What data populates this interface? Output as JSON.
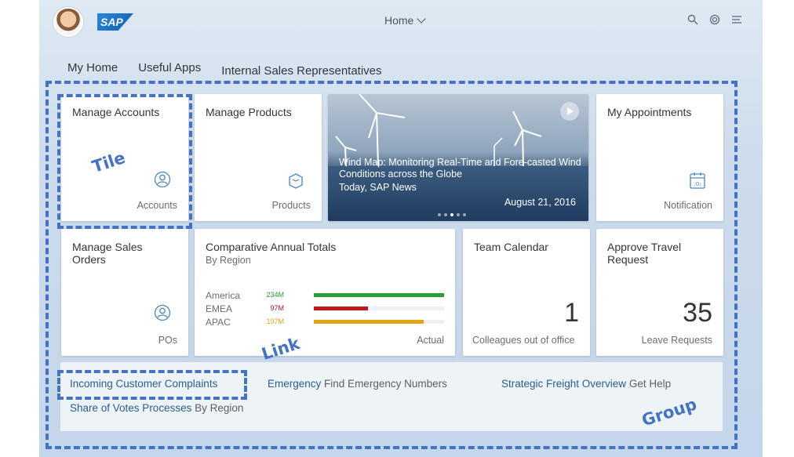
{
  "shell": {
    "home_label": "Home",
    "logo_text": "SAP",
    "icons": [
      "search-icon",
      "copilot-icon",
      "notifications-icon"
    ]
  },
  "tabs": [
    "My Home",
    "Useful Apps",
    "Internal Sales Representatives"
  ],
  "tiles": {
    "manage_accounts": {
      "title": "Manage Accounts",
      "footer": "Accounts",
      "icon": "person-icon"
    },
    "manage_products": {
      "title": "Manage Products",
      "footer": "Products",
      "icon": "product-icon"
    },
    "news": {
      "headline": "Wind Map: Monitoring Real-Time and Fore-casted Wind Conditions across the Globe",
      "source": "Today, SAP News",
      "date": "August 21, 2016"
    },
    "my_appointments": {
      "title": "My Appointments",
      "footer": "Notification",
      "icon": "calendar-icon"
    },
    "manage_sales_orders": {
      "title": "Manage Sales Orders",
      "footer": "POs",
      "icon": "person-icon"
    },
    "comparative": {
      "title": "Comparative Annual Totals",
      "subtitle": "By Region",
      "footer": "Actual",
      "rows": [
        {
          "label": "America",
          "value_label": "234M",
          "value": 234,
          "color": "#2b9d3a"
        },
        {
          "label": "EMEA",
          "value_label": "97M",
          "value": 97,
          "color": "#c0161e"
        },
        {
          "label": "APAC",
          "value_label": "197M",
          "value": 197,
          "color": "#e3a21a"
        }
      ]
    },
    "team_calendar": {
      "title": "Team Calendar",
      "kpi": "1",
      "footer": "Colleagues out of office"
    },
    "approve_travel": {
      "title": "Approve Travel Request",
      "kpi": "35",
      "footer": "Leave Requests"
    }
  },
  "links": {
    "complaints": "Incoming Customer Complaints",
    "emergency": "Emergency",
    "emergency_sub": "Find Emergency Numbers",
    "freight": "Strategic Freight Overview",
    "freight_sub": "Get Help",
    "votes": "Share of Votes Processes",
    "votes_sub": "By Region"
  },
  "annotations": {
    "tile": "Tile",
    "link": "Link",
    "group": "Group"
  },
  "colors": {
    "annotation": "#4472c4",
    "link": "#2a5d92"
  }
}
